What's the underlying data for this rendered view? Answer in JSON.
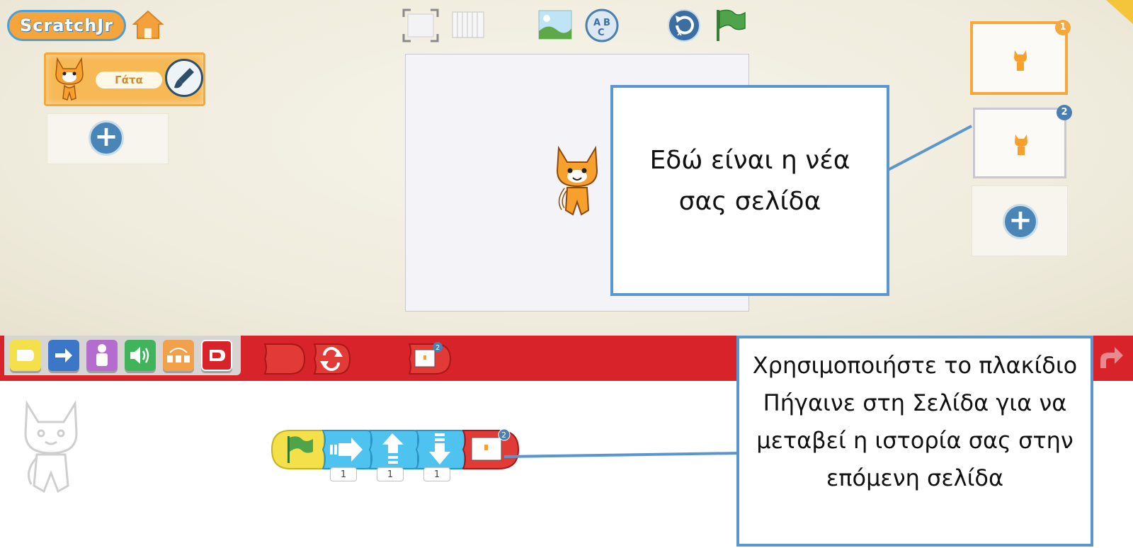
{
  "app": {
    "logo_text": "ScratchJr"
  },
  "sprites": [
    {
      "name": "Γάτα",
      "selected": true
    }
  ],
  "pages": [
    {
      "number": "1",
      "selected": true
    },
    {
      "number": "2",
      "selected": false
    }
  ],
  "callouts": {
    "new_page": "Εδώ είναι η νέα σας σελίδα",
    "go_to_page": "Χρησιμοποιήστε το πλακίδιο Πήγαινε στη Σελίδα για να μεταβεί η ιστορία σας στην επόμενη σελίδα"
  },
  "palette": {
    "categories": [
      "triggering",
      "motion",
      "looks",
      "sound",
      "control",
      "end"
    ],
    "end_blocks": [
      "end",
      "repeat-forever",
      "go-to-page"
    ],
    "go_to_page_number": "2"
  },
  "script": {
    "blocks": [
      {
        "type": "green-flag"
      },
      {
        "type": "move-right",
        "count": "1"
      },
      {
        "type": "move-up",
        "count": "1"
      },
      {
        "type": "move-down",
        "count": "1"
      },
      {
        "type": "go-to-page",
        "page": "2"
      }
    ]
  },
  "colors": {
    "callout_border": "#5b97cf",
    "category_bar": "#d8232a",
    "selected_orange": "#f6a83d"
  }
}
